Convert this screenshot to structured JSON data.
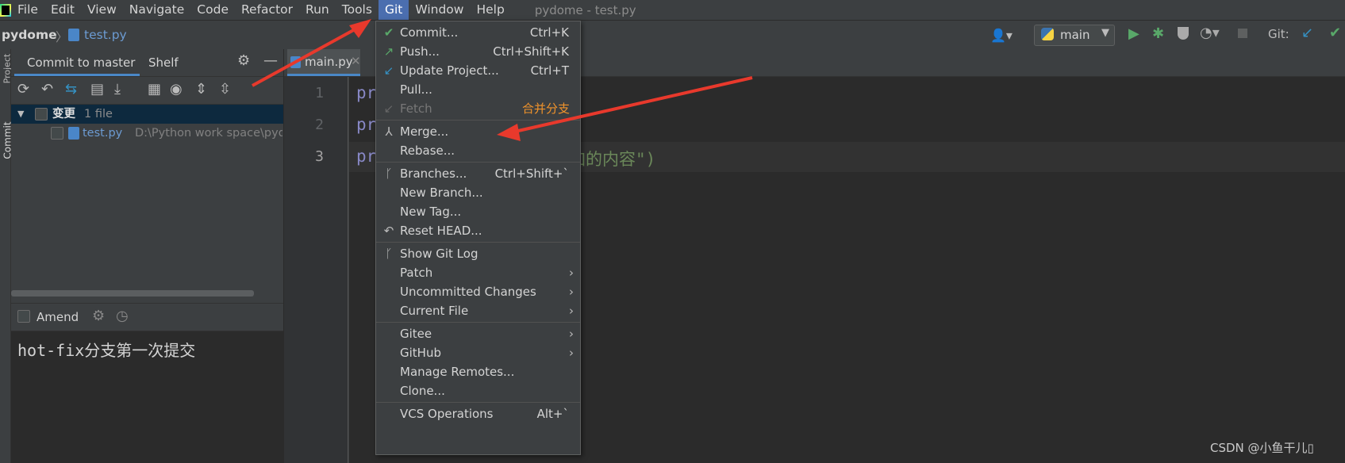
{
  "menubar": {
    "items": [
      "File",
      "Edit",
      "View",
      "Navigate",
      "Code",
      "Refactor",
      "Run",
      "Tools",
      "Git",
      "Window",
      "Help"
    ],
    "title": "pydome - test.py"
  },
  "navbar": {
    "project": "pydome",
    "file": "test.py",
    "branch": "main",
    "git_label": "Git:"
  },
  "sidebar": {
    "stripe_project": "Project",
    "stripe_commit": "Commit"
  },
  "commit_panel": {
    "tab_commit": "Commit to master",
    "tab_shelf": "Shelf",
    "changes_label": "变更",
    "changes_count": "1 file",
    "file_name": "test.py",
    "file_path": "D:\\Python work space\\pyd",
    "amend_label": "Amend",
    "message": "hot-fix分支第一次提交"
  },
  "editor": {
    "tab": "main.py",
    "line_numbers": [
      "1",
      "2",
      "3"
    ],
    "lines": [
      "pr",
      "pr",
      "pr"
    ],
    "line3_tail": "加的内容\")"
  },
  "git_menu": {
    "items": [
      {
        "label": "Commit...",
        "shortcut": "Ctrl+K",
        "icon": "check-icon"
      },
      {
        "label": "Push...",
        "shortcut": "Ctrl+Shift+K",
        "icon": "push-arrow-icon"
      },
      {
        "label": "Update Project...",
        "shortcut": "Ctrl+T",
        "icon": "update-arrow-icon"
      },
      {
        "label": "Pull...",
        "shortcut": "",
        "icon": ""
      },
      {
        "label": "Fetch",
        "shortcut": "",
        "icon": "fetch-icon",
        "disabled": true
      },
      {
        "label": "Merge...",
        "shortcut": "",
        "icon": "merge-icon"
      },
      {
        "label": "Rebase...",
        "shortcut": "",
        "icon": ""
      },
      {
        "label": "Branches...",
        "shortcut": "Ctrl+Shift+`",
        "icon": "branch-icon"
      },
      {
        "label": "New Branch...",
        "shortcut": "",
        "icon": ""
      },
      {
        "label": "New Tag...",
        "shortcut": "",
        "icon": ""
      },
      {
        "label": "Reset HEAD...",
        "shortcut": "",
        "icon": "reset-icon"
      },
      {
        "label": "Show Git Log",
        "shortcut": "",
        "icon": "git-log-icon"
      },
      {
        "label": "Patch",
        "shortcut": "",
        "icon": "",
        "submenu": true
      },
      {
        "label": "Uncommitted Changes",
        "shortcut": "",
        "icon": "",
        "submenu": true
      },
      {
        "label": "Current File",
        "shortcut": "",
        "icon": "",
        "submenu": true
      },
      {
        "label": "Gitee",
        "shortcut": "",
        "icon": "",
        "submenu": true
      },
      {
        "label": "GitHub",
        "shortcut": "",
        "icon": "",
        "submenu": true
      },
      {
        "label": "Manage Remotes...",
        "shortcut": "",
        "icon": ""
      },
      {
        "label": "Clone...",
        "shortcut": "",
        "icon": ""
      },
      {
        "label": "VCS Operations",
        "shortcut": "Alt+`",
        "icon": ""
      }
    ]
  },
  "annotation": {
    "merge_note": "合并分支",
    "watermark": "CSDN @小鱼干儿▯"
  },
  "colors": {
    "accent": "#4b6eaf",
    "arrow": "#e8392c",
    "note": "#f0932b"
  }
}
